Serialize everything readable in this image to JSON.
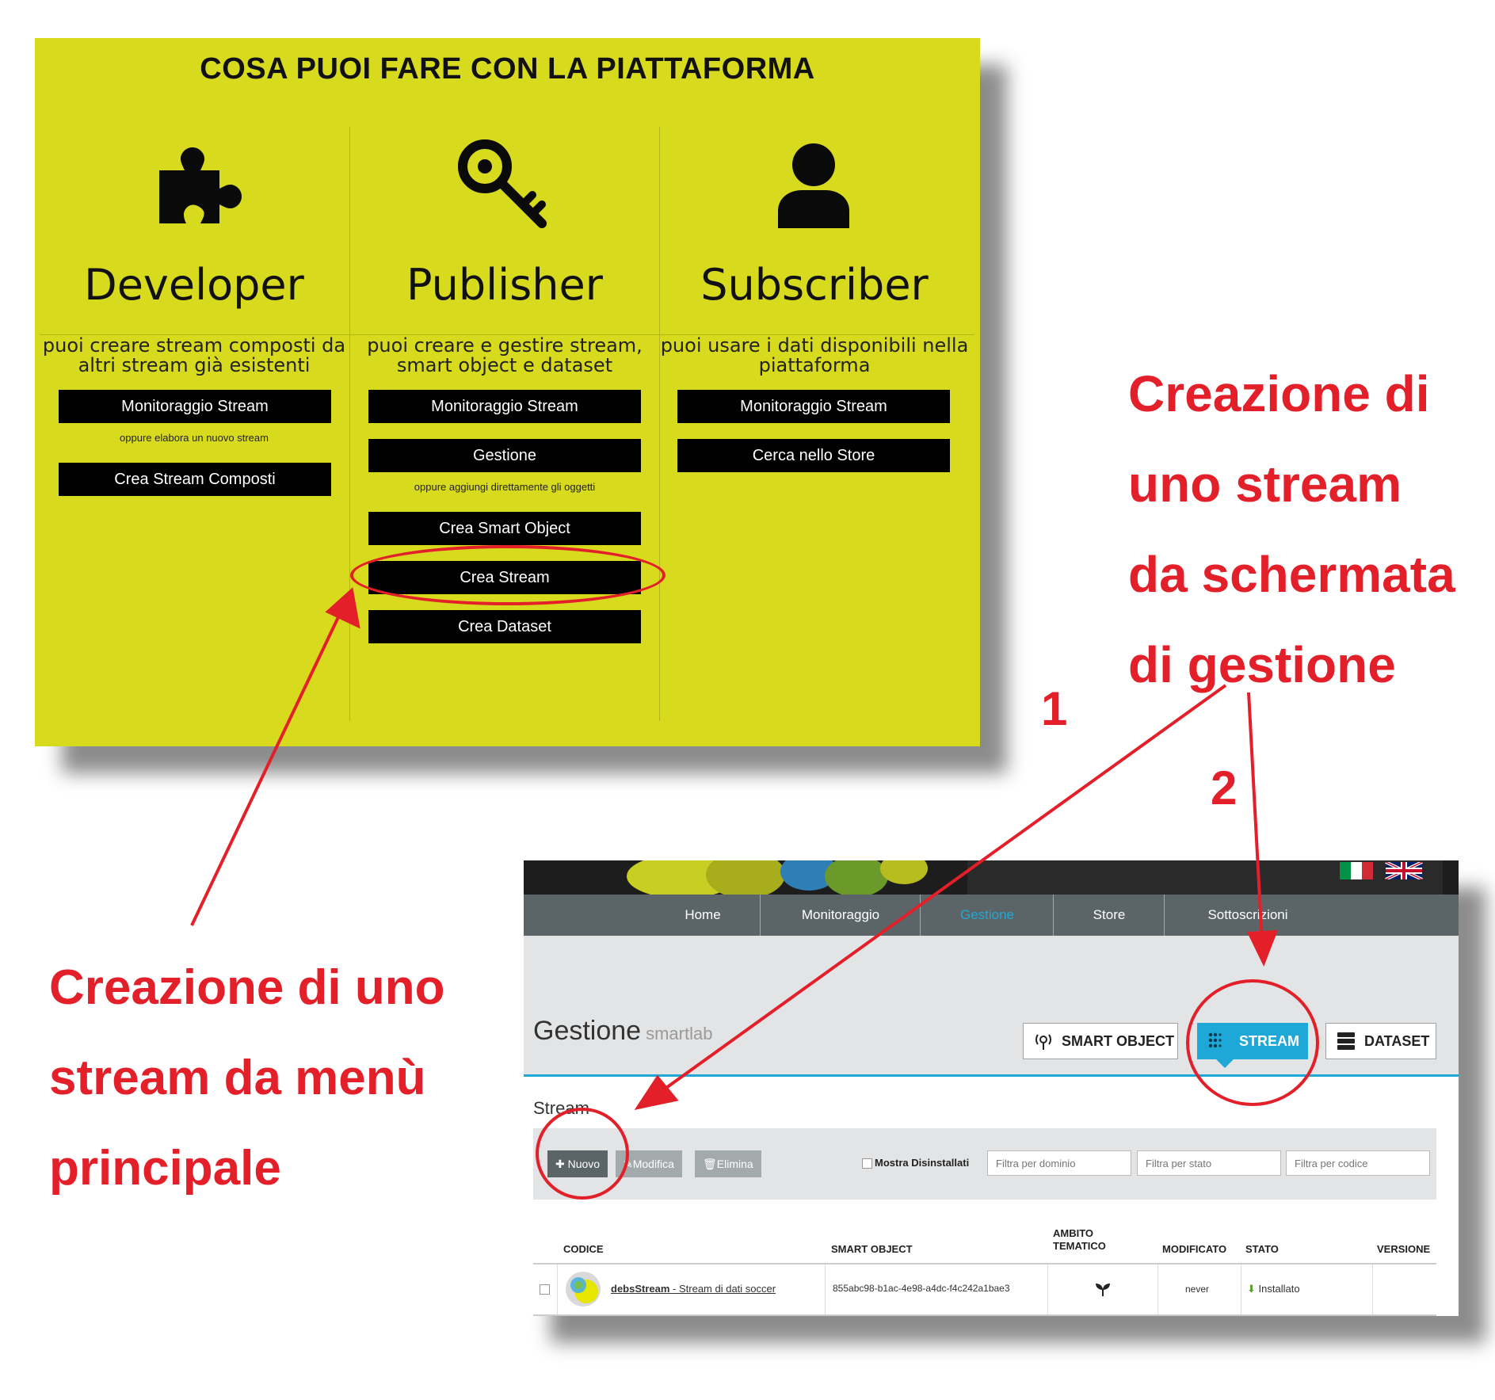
{
  "panel1": {
    "title": "COSA PUOI FARE CON LA PIATTAFORMA",
    "columns": [
      {
        "title": "Developer",
        "icon": "puzzle-icon",
        "description": "puoi creare stream composti da altri stream già esistenti",
        "buttons": [
          "Monitoraggio Stream",
          "Crea Stream Composti"
        ],
        "note": "oppure elabora un nuovo stream"
      },
      {
        "title": "Publisher",
        "icon": "key-icon",
        "description": "puoi creare e gestire stream, smart object e dataset",
        "buttons": [
          "Monitoraggio Stream",
          "Gestione",
          "Crea Smart Object",
          "Crea Stream",
          "Crea Dataset"
        ],
        "note": "oppure aggiungi direttamente gli oggetti"
      },
      {
        "title": "Subscriber",
        "icon": "user-icon",
        "description": "puoi usare i dati disponibili nella piattaforma",
        "buttons": [
          "Monitoraggio Stream",
          "Cerca nello Store"
        ]
      }
    ]
  },
  "annotations": {
    "right": [
      "Creazione di",
      "uno stream",
      "da schermata",
      "di gestione"
    ],
    "left": [
      "Creazione di uno",
      "stream da menù",
      "principale"
    ],
    "step1": "1",
    "step2": "2",
    "color": "#e3202a"
  },
  "panel2": {
    "nav": [
      "Home",
      "Monitoraggio",
      "Gestione",
      "Store",
      "Sottoscrizioni"
    ],
    "active_nav": "Gestione",
    "page_title": "Gestione",
    "page_subtitle": "smartlab",
    "tabs": [
      "SMART OBJECT",
      "STREAM",
      "DATASET"
    ],
    "active_tab": "STREAM",
    "section_title": "Stream",
    "toolbar": {
      "new_label": "Nuovo",
      "edit_label": "Modifica",
      "delete_label": "Elimina",
      "show_uninstalled_label": "Mostra Disinstallati",
      "filter_domain_placeholder": "Filtra per dominio",
      "filter_state_placeholder": "Filtra per stato",
      "filter_code_placeholder": "Filtra per codice"
    },
    "table": {
      "headers": [
        "CODICE",
        "SMART OBJECT",
        "AMBITO TEMATICO",
        "MODIFICATO",
        "STATO",
        "VERSIONE"
      ],
      "rows": [
        {
          "code": "debsStream",
          "code_desc": " - Stream di dati soccer",
          "smart_object": "855abc98-b1ac-4e98-a4dc-f4c242a1bae3",
          "domain_icon": "leaf-icon",
          "modified": "never",
          "state": "Installato",
          "version": ""
        }
      ]
    },
    "accent_color": "#1ea8d8",
    "nav_color": "#5b6567"
  }
}
